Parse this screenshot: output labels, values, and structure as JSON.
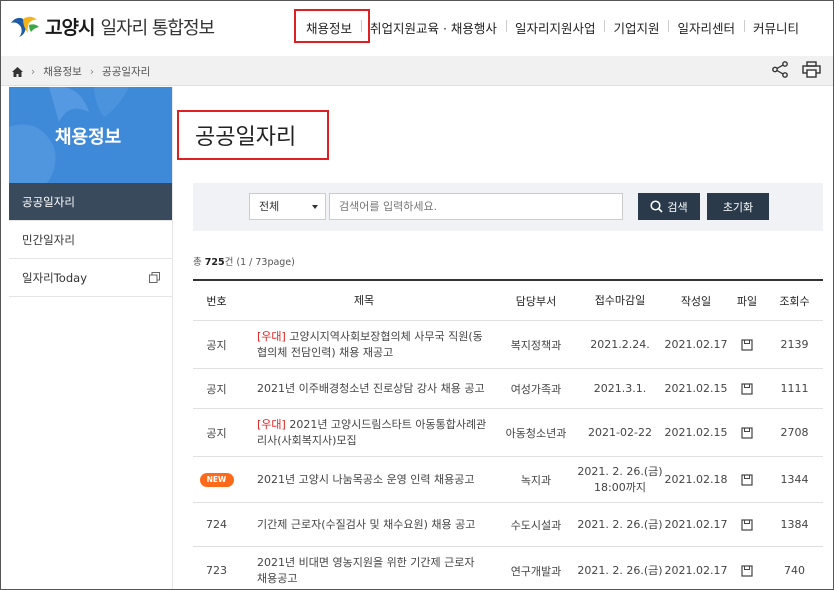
{
  "header": {
    "logo_main": "고양시",
    "logo_sub": "일자리 통합정보",
    "nav": [
      "채용정보",
      "취업지원교육 · 채용행사",
      "일자리지원사업",
      "기업지원",
      "일자리센터",
      "커뮤니티"
    ]
  },
  "breadcrumb": {
    "items": [
      "채용정보",
      "공공일자리"
    ]
  },
  "sidebar": {
    "title": "채용정보",
    "items": [
      {
        "label": "공공일자리"
      },
      {
        "label": "민간일자리"
      },
      {
        "label": "일자리Today"
      }
    ]
  },
  "main": {
    "title": "공공일자리",
    "search": {
      "select_value": "전체",
      "placeholder": "검색어를 입력하세요.",
      "search_label": "검색",
      "reset_label": "초기화"
    },
    "count": {
      "prefix": "총 ",
      "total": "725",
      "suffix": "건 (1 / 73page)"
    },
    "table": {
      "headers": [
        "번호",
        "제목",
        "담당부서",
        "접수마감일",
        "작성일",
        "파일",
        "조회수"
      ],
      "rows": [
        {
          "no": "공지",
          "tag": "[우대]",
          "title": " 고양시지역사회보장협의체 사무국 직원(동협의체 전담인력) 채용 재공고",
          "dept": "복지정책과",
          "deadline": "2021.2.24.",
          "date": "2021.02.17",
          "views": "2139"
        },
        {
          "no": "공지",
          "tag": "",
          "title": "2021년 이주배경청소년 진로상담 강사 채용 공고",
          "dept": "여성가족과",
          "deadline": "2021.3.1.",
          "date": "2021.02.15",
          "views": "1111"
        },
        {
          "no": "공지",
          "tag": "[우대]",
          "title": " 2021년 고양시드림스타트 아동통합사례관리사(사회복지사)모집",
          "dept": "아동청소년과",
          "deadline": "2021-02-22",
          "date": "2021.02.15",
          "views": "2708"
        },
        {
          "no": "NEW",
          "tag": "",
          "title": "2021년 고양시 나눔목공소 운영 인력 채용공고",
          "dept": "녹지과",
          "deadline": "2021. 2. 26.(금) 18:00까지",
          "date": "2021.02.18",
          "views": "1344"
        },
        {
          "no": "724",
          "tag": "",
          "title": "기간제 근로자(수질검사 및 채수요원) 채용 공고",
          "dept": "수도시설과",
          "deadline": "2021. 2. 26.(금)",
          "date": "2021.02.17",
          "views": "1384"
        },
        {
          "no": "723",
          "tag": "",
          "title": "2021년 비대면 영농지원을 위한 기간제 근로자 채용공고",
          "dept": "연구개발과",
          "deadline": "2021. 2. 26.(금)",
          "date": "2021.02.17",
          "views": "740"
        }
      ]
    }
  }
}
